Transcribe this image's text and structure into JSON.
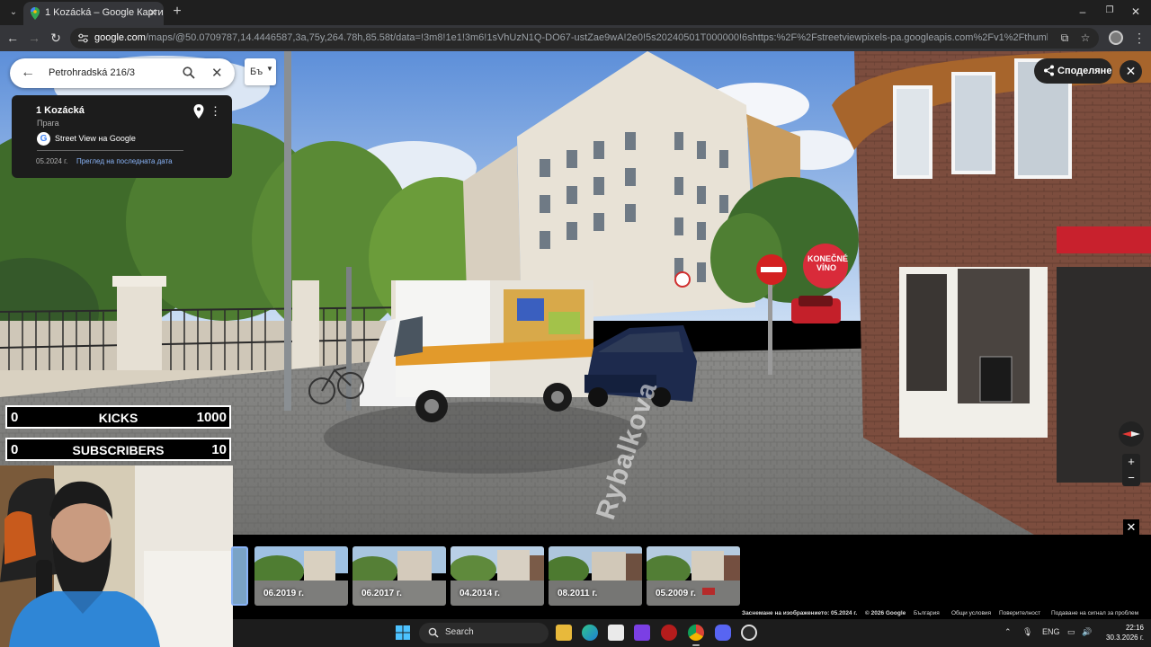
{
  "browser": {
    "tab_title": "1 Kozácká – Google Карти",
    "url_host": "google.com",
    "url_rest": "/maps/@50.0709787,14.4446587,3a,75y,264.78h,85.58t/data=!3m8!1e1!3m6!1sVhUzN1Q-DO67-ustZae9wA!2e0!5s20240501T000000!6shttps:%2F%2Fstreetviewpixels-pa.googleapis.com%2Fv1%2Fthumbnail%3Fcb_client%3Dmaps_sv.tactile%26w..."
  },
  "search": {
    "value": "Petrohradská 216/3"
  },
  "language_button": {
    "label": "Бъ"
  },
  "infocard": {
    "title": "1 Kozácká",
    "subtitle": "Прага",
    "provider": "Street View на Google",
    "date": "05.2024 г.",
    "latest_link": "Преглед на последната дата"
  },
  "share": {
    "label": "Споделяне"
  },
  "scene": {
    "street_name": "Rybalkova",
    "sign_text": "KONEČNÉ VÍNO"
  },
  "counters": [
    {
      "left": "0",
      "label": "KICKS",
      "right": "1000"
    },
    {
      "left": "0",
      "label": "SUBSCRIBERS",
      "right": "10"
    }
  ],
  "filmstrip": {
    "thumbs": [
      {
        "date": "06.2019 г."
      },
      {
        "date": "06.2017 г."
      },
      {
        "date": "04.2014 г."
      },
      {
        "date": "08.2011 г."
      },
      {
        "date": "05.2009 г."
      }
    ]
  },
  "footer": {
    "capture": "Заснемане на изображението: 05.2024 г.",
    "copyright": "© 2026 Google",
    "country": "България",
    "terms": "Общи условия",
    "privacy": "Поверителност",
    "report": "Подаване на сигнал за проблем"
  },
  "taskbar": {
    "search_label": "Search",
    "lang": "ENG",
    "time": "22:16",
    "date": "30.3.2026 г."
  }
}
